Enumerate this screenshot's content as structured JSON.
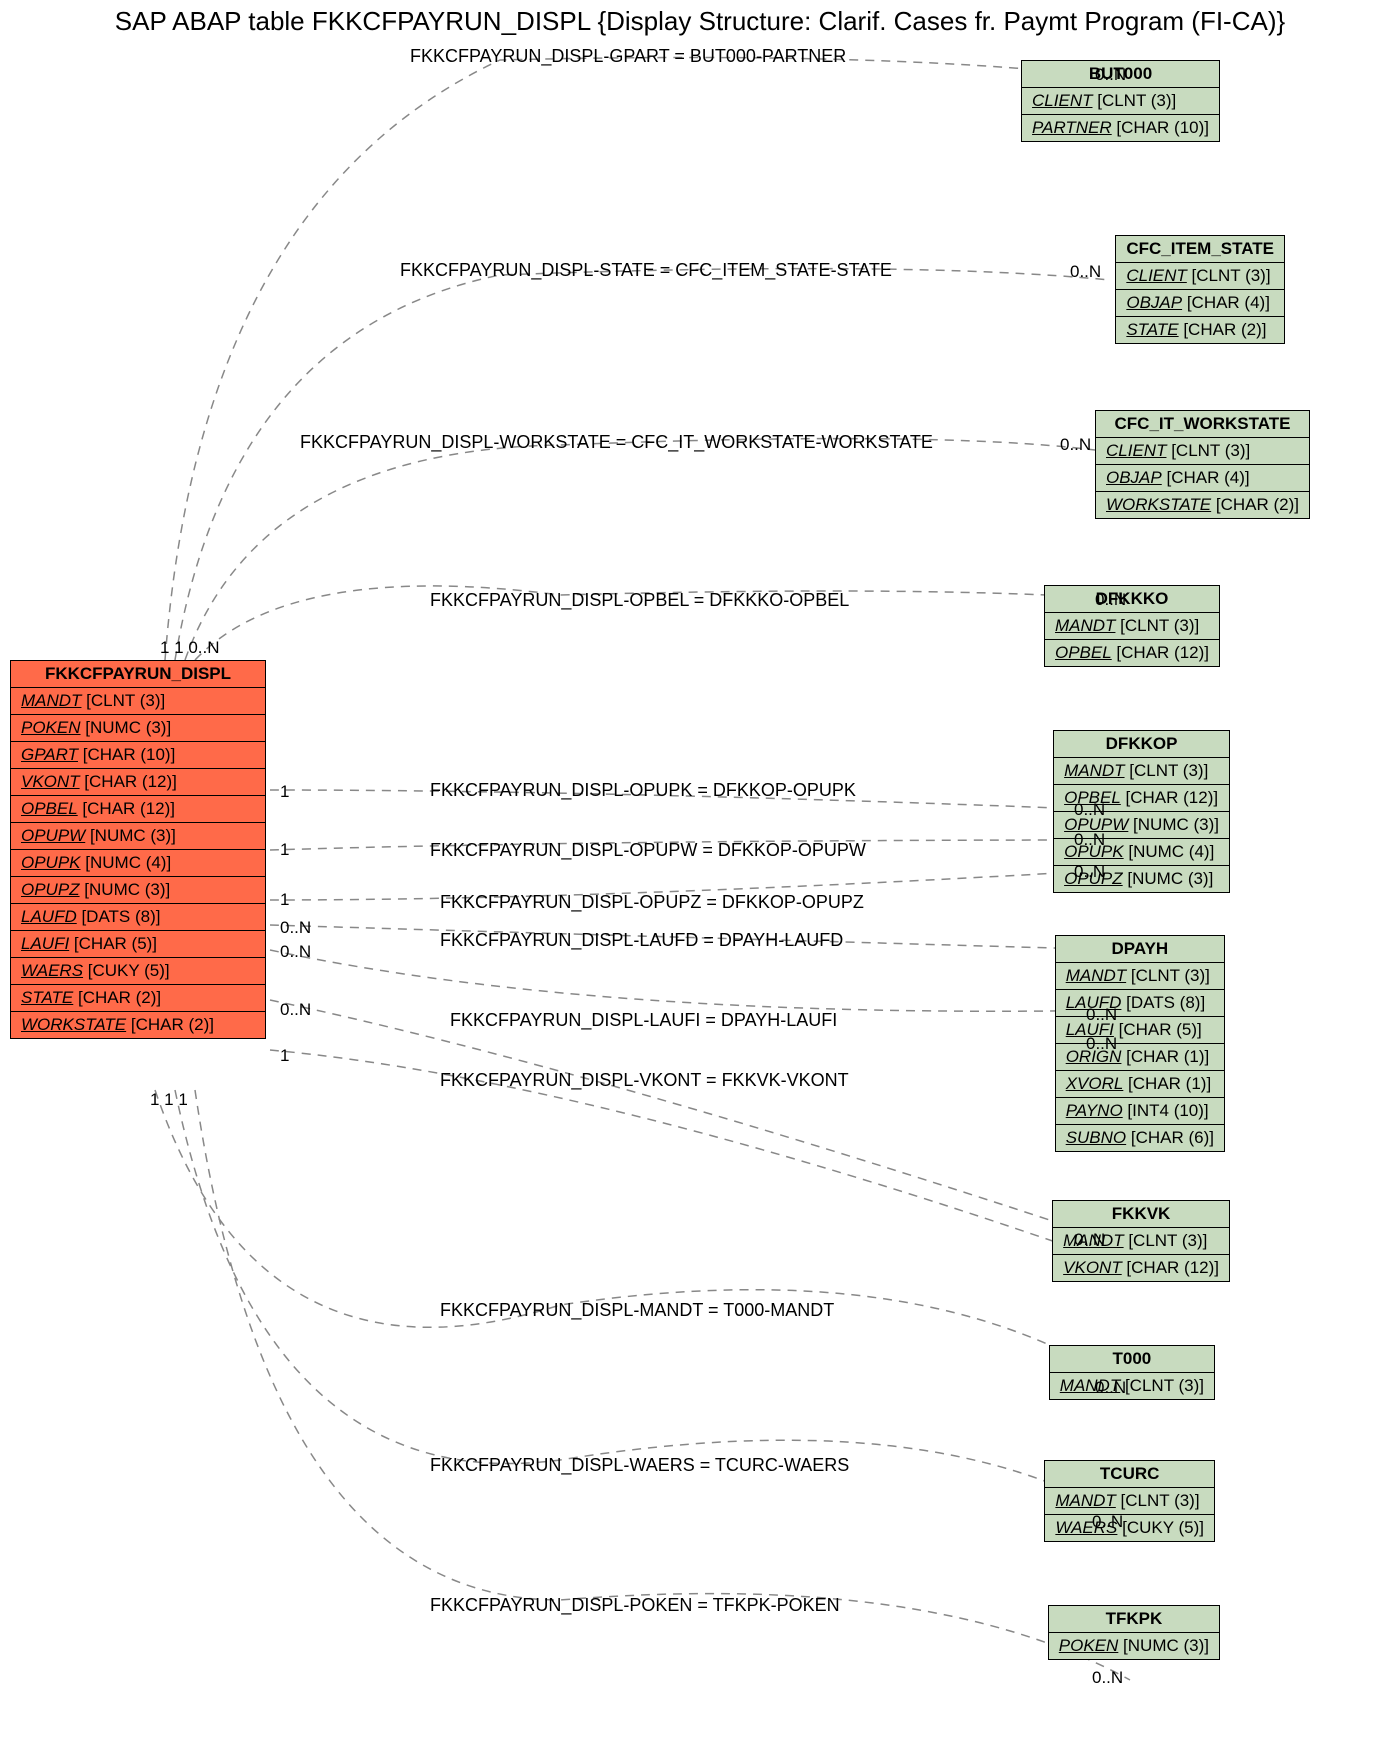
{
  "title": "SAP ABAP table FKKCFPAYRUN_DISPL {Display Structure: Clarif. Cases fr. Paymt Program (FI-CA)}",
  "main": {
    "name": "FKKCFPAYRUN_DISPL",
    "fields": [
      {
        "f": "MANDT",
        "t": "[CLNT (3)]"
      },
      {
        "f": "POKEN",
        "t": "[NUMC (3)]"
      },
      {
        "f": "GPART",
        "t": "[CHAR (10)]"
      },
      {
        "f": "VKONT",
        "t": "[CHAR (12)]"
      },
      {
        "f": "OPBEL",
        "t": "[CHAR (12)]"
      },
      {
        "f": "OPUPW",
        "t": "[NUMC (3)]"
      },
      {
        "f": "OPUPK",
        "t": "[NUMC (4)]"
      },
      {
        "f": "OPUPZ",
        "t": "[NUMC (3)]"
      },
      {
        "f": "LAUFD",
        "t": "[DATS (8)]"
      },
      {
        "f": "LAUFI",
        "t": "[CHAR (5)]"
      },
      {
        "f": "WAERS",
        "t": "[CUKY (5)]"
      },
      {
        "f": "STATE",
        "t": "[CHAR (2)]"
      },
      {
        "f": "WORKSTATE",
        "t": "[CHAR (2)]"
      }
    ]
  },
  "refs": [
    {
      "name": "BUT000",
      "fields": [
        {
          "f": "CLIENT",
          "t": "[CLNT (3)]"
        },
        {
          "f": "PARTNER",
          "t": "[CHAR (10)]"
        }
      ]
    },
    {
      "name": "CFC_ITEM_STATE",
      "fields": [
        {
          "f": "CLIENT",
          "t": "[CLNT (3)]"
        },
        {
          "f": "OBJAP",
          "t": "[CHAR (4)]"
        },
        {
          "f": "STATE",
          "t": "[CHAR (2)]"
        }
      ]
    },
    {
      "name": "CFC_IT_WORKSTATE",
      "fields": [
        {
          "f": "CLIENT",
          "t": "[CLNT (3)]"
        },
        {
          "f": "OBJAP",
          "t": "[CHAR (4)]"
        },
        {
          "f": "WORKSTATE",
          "t": "[CHAR (2)]"
        }
      ]
    },
    {
      "name": "DFKKKO",
      "fields": [
        {
          "f": "MANDT",
          "t": "[CLNT (3)]"
        },
        {
          "f": "OPBEL",
          "t": "[CHAR (12)]"
        }
      ]
    },
    {
      "name": "DFKKOP",
      "fields": [
        {
          "f": "MANDT",
          "t": "[CLNT (3)]"
        },
        {
          "f": "OPBEL",
          "t": "[CHAR (12)]"
        },
        {
          "f": "OPUPW",
          "t": "[NUMC (3)]"
        },
        {
          "f": "OPUPK",
          "t": "[NUMC (4)]"
        },
        {
          "f": "OPUPZ",
          "t": "[NUMC (3)]"
        }
      ]
    },
    {
      "name": "DPAYH",
      "fields": [
        {
          "f": "MANDT",
          "t": "[CLNT (3)]"
        },
        {
          "f": "LAUFD",
          "t": "[DATS (8)]"
        },
        {
          "f": "LAUFI",
          "t": "[CHAR (5)]"
        },
        {
          "f": "ORIGN",
          "t": "[CHAR (1)]"
        },
        {
          "f": "XVORL",
          "t": "[CHAR (1)]"
        },
        {
          "f": "PAYNO",
          "t": "[INT4 (10)]"
        },
        {
          "f": "SUBNO",
          "t": "[CHAR (6)]"
        }
      ]
    },
    {
      "name": "FKKVK",
      "fields": [
        {
          "f": "MANDT",
          "t": "[CLNT (3)]"
        },
        {
          "f": "VKONT",
          "t": "[CHAR (12)]"
        }
      ]
    },
    {
      "name": "T000",
      "fields": [
        {
          "f": "MANDT",
          "t": "[CLNT (3)]"
        }
      ]
    },
    {
      "name": "TCURC",
      "fields": [
        {
          "f": "MANDT",
          "t": "[CLNT (3)]"
        },
        {
          "f": "WAERS",
          "t": "[CUKY (5)]"
        }
      ]
    },
    {
      "name": "TFKPK",
      "fields": [
        {
          "f": "POKEN",
          "t": "[NUMC (3)]"
        }
      ]
    }
  ],
  "rels": [
    "FKKCFPAYRUN_DISPL-GPART = BUT000-PARTNER",
    "FKKCFPAYRUN_DISPL-STATE = CFC_ITEM_STATE-STATE",
    "FKKCFPAYRUN_DISPL-WORKSTATE = CFC_IT_WORKSTATE-WORKSTATE",
    "FKKCFPAYRUN_DISPL-OPBEL = DFKKKO-OPBEL",
    "FKKCFPAYRUN_DISPL-OPUPK = DFKKOP-OPUPK",
    "FKKCFPAYRUN_DISPL-OPUPW = DFKKOP-OPUPW",
    "FKKCFPAYRUN_DISPL-OPUPZ = DFKKOP-OPUPZ",
    "FKKCFPAYRUN_DISPL-LAUFD = DPAYH-LAUFD",
    "FKKCFPAYRUN_DISPL-LAUFI = DPAYH-LAUFI",
    "FKKCFPAYRUN_DISPL-VKONT = FKKVK-VKONT",
    "FKKCFPAYRUN_DISPL-MANDT = T000-MANDT",
    "FKKCFPAYRUN_DISPL-WAERS = TCURC-WAERS",
    "FKKCFPAYRUN_DISPL-POKEN = TFKPK-POKEN"
  ],
  "cards_main_top": "1 1  0..N",
  "cards_main_bot": "1  1   1",
  "cards_main_right": [
    "1",
    "1",
    "1",
    "0..N",
    "0..N",
    "0..N",
    "1"
  ],
  "cards_right_side": [
    "0..N",
    "0..N",
    "0..N",
    "0..N",
    "0..N",
    "0..N",
    "0..N",
    "0..N",
    "0..N",
    "0..N",
    "0..N",
    "0..N",
    "0..N"
  ]
}
